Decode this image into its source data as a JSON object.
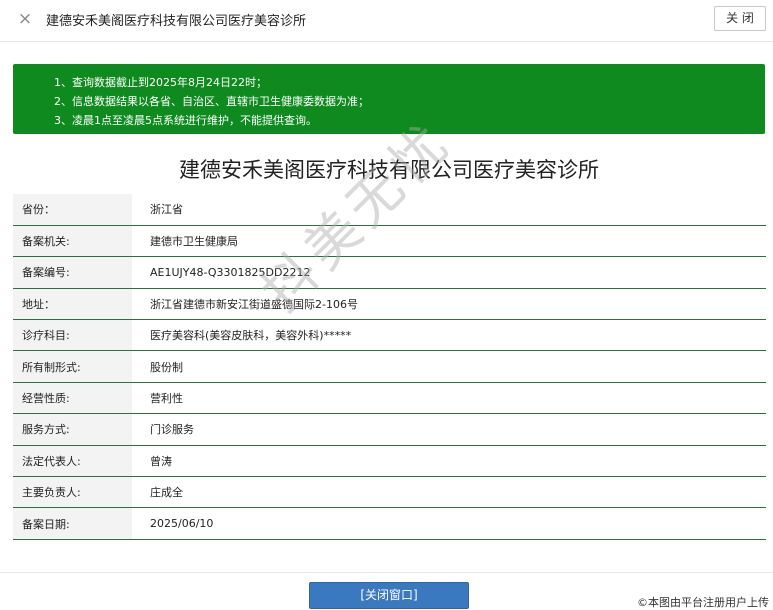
{
  "window": {
    "close_icon": "×",
    "title": "建德安禾美阁医疗科技有限公司医疗美容诊所",
    "close_label": "关 闭"
  },
  "notice": {
    "lines": [
      "1、查询数据截止到2025年8月24日22时；",
      "2、信息数据结果以各省、自治区、直辖市卫生健康委数据为准；",
      "3、凌晨1点至凌晨5点系统进行维护，不能提供查询。"
    ],
    "background": "#0f8a1f"
  },
  "main_title": "建德安禾美阁医疗科技有限公司医疗美容诊所",
  "rows": [
    {
      "key": "省份：",
      "value": "浙江省"
    },
    {
      "key": "备案机关:",
      "value": "建德市卫生健康局"
    },
    {
      "key": "备案编号:",
      "value": "AE1UJY48-Q3301825DD2212"
    },
    {
      "key": "地址：",
      "value": "浙江省建德市新安江街道盛德国际2-106号"
    },
    {
      "key": "诊疗科目:",
      "value": "医疗美容科(美容皮肤科，美容外科)*****"
    },
    {
      "key": "所有制形式:",
      "value": "股份制"
    },
    {
      "key": "经营性质:",
      "value": "营利性"
    },
    {
      "key": "服务方式:",
      "value": "门诊服务"
    },
    {
      "key": "法定代表人:",
      "value": "曾涛"
    },
    {
      "key": "主要负责人:",
      "value": "庄成全"
    },
    {
      "key": "备案日期:",
      "value": "2025/06/10"
    }
  ],
  "watermark": "抖美无忧",
  "footer": {
    "close_window_label": "[关闭窗口]",
    "source_note": "©本图由平台注册用户上传"
  },
  "colors": {
    "row_divider": "#2f6f3e",
    "button_blue": "#3a79bf"
  }
}
